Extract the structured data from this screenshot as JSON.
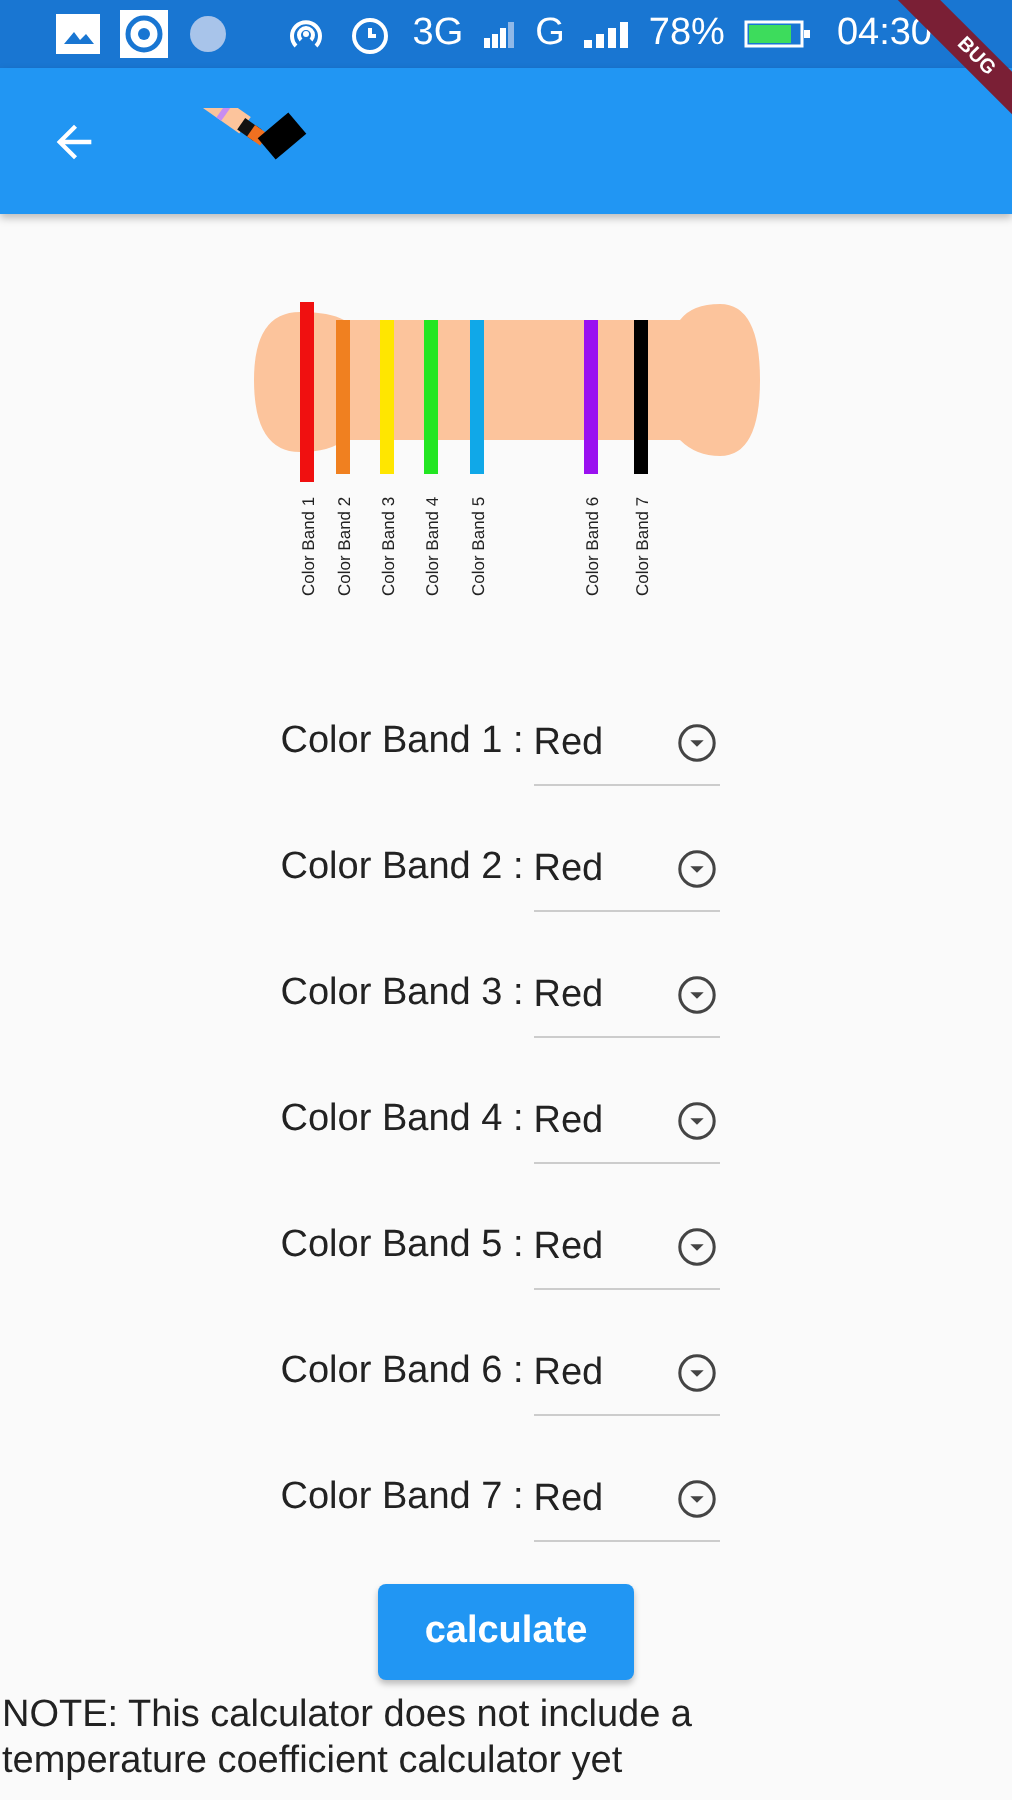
{
  "status_bar": {
    "network": "3G",
    "network_2": "G",
    "battery": "78%",
    "time": "04:30"
  },
  "debug_banner": "BUG",
  "resistor": {
    "bands": [
      {
        "label": "Color Band 1",
        "color": "#f01010"
      },
      {
        "label": "Color Band 2",
        "color": "#f08020"
      },
      {
        "label": "Color Band 3",
        "color": "#ffe600"
      },
      {
        "label": "Color Band 4",
        "color": "#22e622"
      },
      {
        "label": "Color Band 5",
        "color": "#10a8e8"
      },
      {
        "label": "Color Band 6",
        "color": "#9a10f0"
      },
      {
        "label": "Color Band 7",
        "color": "#000000"
      }
    ]
  },
  "selectors": [
    {
      "label": "Color Band 1 :",
      "value": "Red"
    },
    {
      "label": "Color Band 2 :",
      "value": "Red"
    },
    {
      "label": "Color Band 3 :",
      "value": "Red"
    },
    {
      "label": "Color Band 4 :",
      "value": "Red"
    },
    {
      "label": "Color Band 5 :",
      "value": "Red"
    },
    {
      "label": "Color Band 6 :",
      "value": "Red"
    },
    {
      "label": "Color Band 7 :",
      "value": "Red"
    }
  ],
  "calculate_button": "calculate",
  "note": "NOTE: This calculator does not include a temperature coefficient calculator yet"
}
